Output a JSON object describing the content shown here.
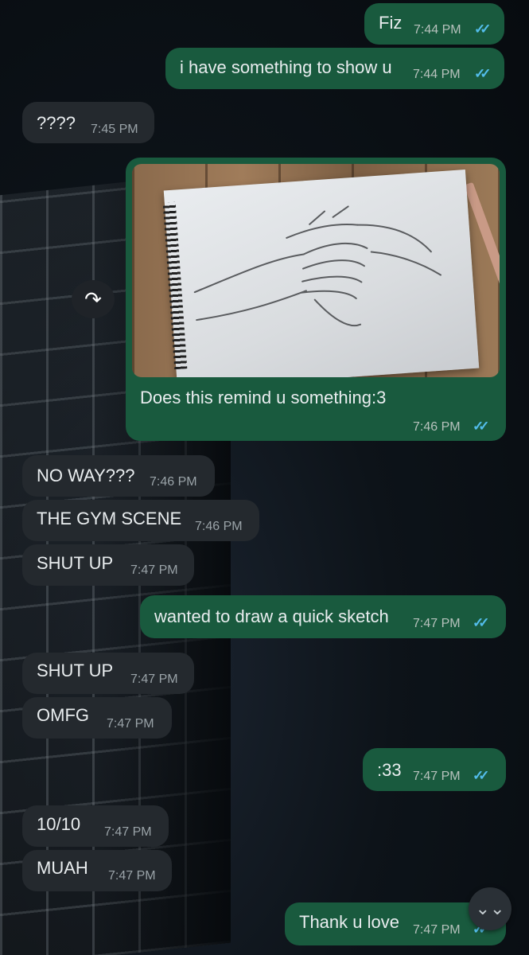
{
  "messages": [
    {
      "text": "Fiz",
      "time": "7:44 PM"
    },
    {
      "text": "i have something to show u",
      "time": "7:44 PM"
    },
    {
      "text": "????",
      "time": "7:45 PM"
    },
    {
      "text": "Does this remind u something:3",
      "time": "7:46 PM"
    },
    {
      "text": "NO WAY???",
      "time": "7:46 PM"
    },
    {
      "text": "THE GYM SCENE",
      "time": "7:46 PM"
    },
    {
      "text": "SHUT UP",
      "time": "7:47 PM"
    },
    {
      "text": "wanted to draw a quick sketch",
      "time": "7:47 PM"
    },
    {
      "text": "SHUT UP",
      "time": "7:47 PM"
    },
    {
      "text": "OMFG",
      "time": "7:47 PM"
    },
    {
      "text": ":33",
      "time": "7:47 PM"
    },
    {
      "text": "10/10",
      "time": "7:47 PM"
    },
    {
      "text": "MUAH",
      "time": "7:47 PM"
    },
    {
      "text": "Thank u love",
      "time": "7:47 PM"
    }
  ],
  "icons": {
    "read_ticks": "✓✓",
    "forward": "↷",
    "scroll_down": "⌄⌄",
    "image_subject": "pencil sketch of two hands"
  },
  "colors": {
    "outgoing_bubble": "#195a3e",
    "incoming_bubble": "#24292e",
    "read_tick": "#53bdeb"
  }
}
